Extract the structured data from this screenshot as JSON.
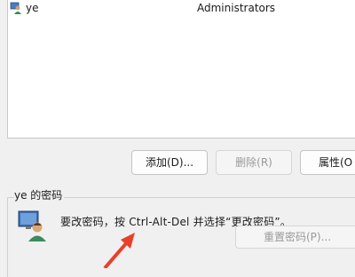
{
  "users": [
    {
      "name": "ye",
      "group": "Administrators"
    }
  ],
  "buttons": {
    "add": "添加(D)...",
    "remove": "删除(R)",
    "properties": "属性(O"
  },
  "password_group": {
    "title": "ye 的密码",
    "message": "要改密码，按 Ctrl-Alt-Del 并选择“更改密码”。",
    "reset_button": "重置密码(P)..."
  },
  "colors": {
    "arrow": "#e8402a",
    "disabled_text": "#9a9a9a"
  }
}
